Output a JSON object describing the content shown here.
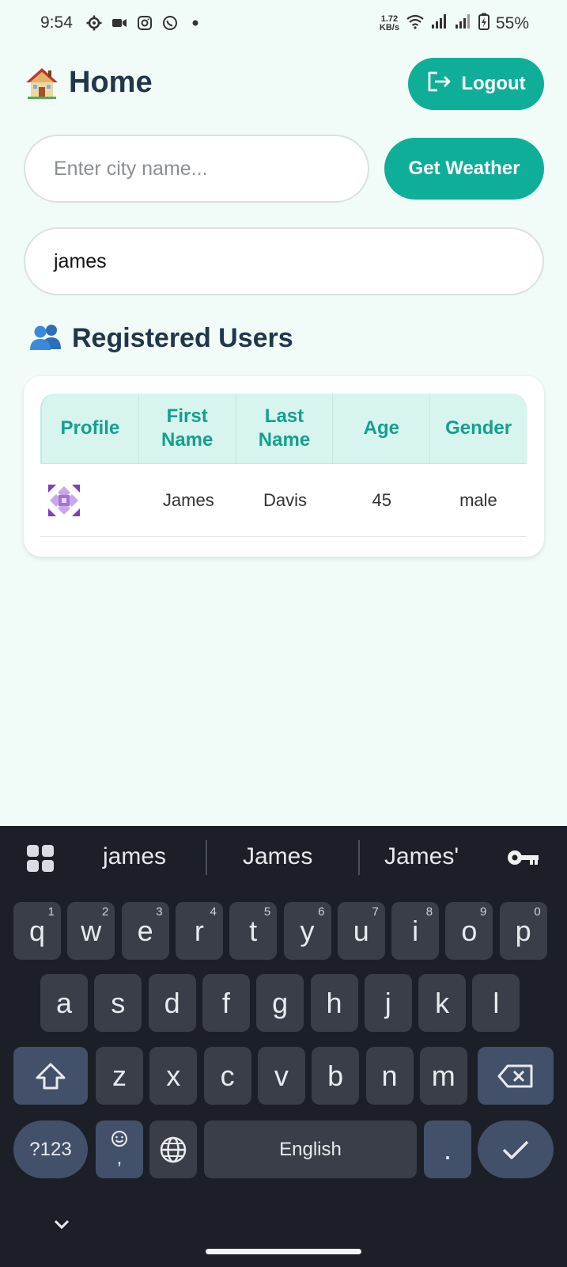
{
  "status": {
    "time": "9:54",
    "speed_top": "1.72",
    "speed_bottom": "KB/s",
    "battery": "55%",
    "icons": [
      "settings-icon",
      "video-icon",
      "instagram-icon",
      "whatsapp-icon",
      "dot-icon",
      "wifi-icon",
      "signal-icon",
      "signal-icon",
      "battery-icon"
    ]
  },
  "header": {
    "title": "Home",
    "logout_label": "Logout"
  },
  "city": {
    "placeholder": "Enter city name...",
    "button_label": "Get Weather"
  },
  "search": {
    "value": "james"
  },
  "users": {
    "title": "Registered Users",
    "columns": {
      "profile": "Profile",
      "first_a": "First",
      "first_b": "Name",
      "last_a": "Last",
      "last_b": "Name",
      "age": "Age",
      "gender": "Gender"
    },
    "rows": [
      {
        "first": "James",
        "last": "Davis",
        "age": "45",
        "gender": "male"
      }
    ]
  },
  "keyboard": {
    "suggestions": [
      "james",
      "James",
      "James'"
    ],
    "row1": [
      "q",
      "w",
      "e",
      "r",
      "t",
      "y",
      "u",
      "i",
      "o",
      "p"
    ],
    "row1_nums": [
      "1",
      "2",
      "3",
      "4",
      "5",
      "6",
      "7",
      "8",
      "9",
      "0"
    ],
    "row2": [
      "a",
      "s",
      "d",
      "f",
      "g",
      "h",
      "j",
      "k",
      "l"
    ],
    "row3": [
      "z",
      "x",
      "c",
      "v",
      "b",
      "n",
      "m"
    ],
    "symbols_label": "?123",
    "space_label": "English",
    "period_label": ".",
    "comma_label": ","
  },
  "colors": {
    "accent": "#0fae99",
    "background": "#f1fbf8",
    "title": "#22364a",
    "keyboard_bg": "#1c1f27"
  }
}
